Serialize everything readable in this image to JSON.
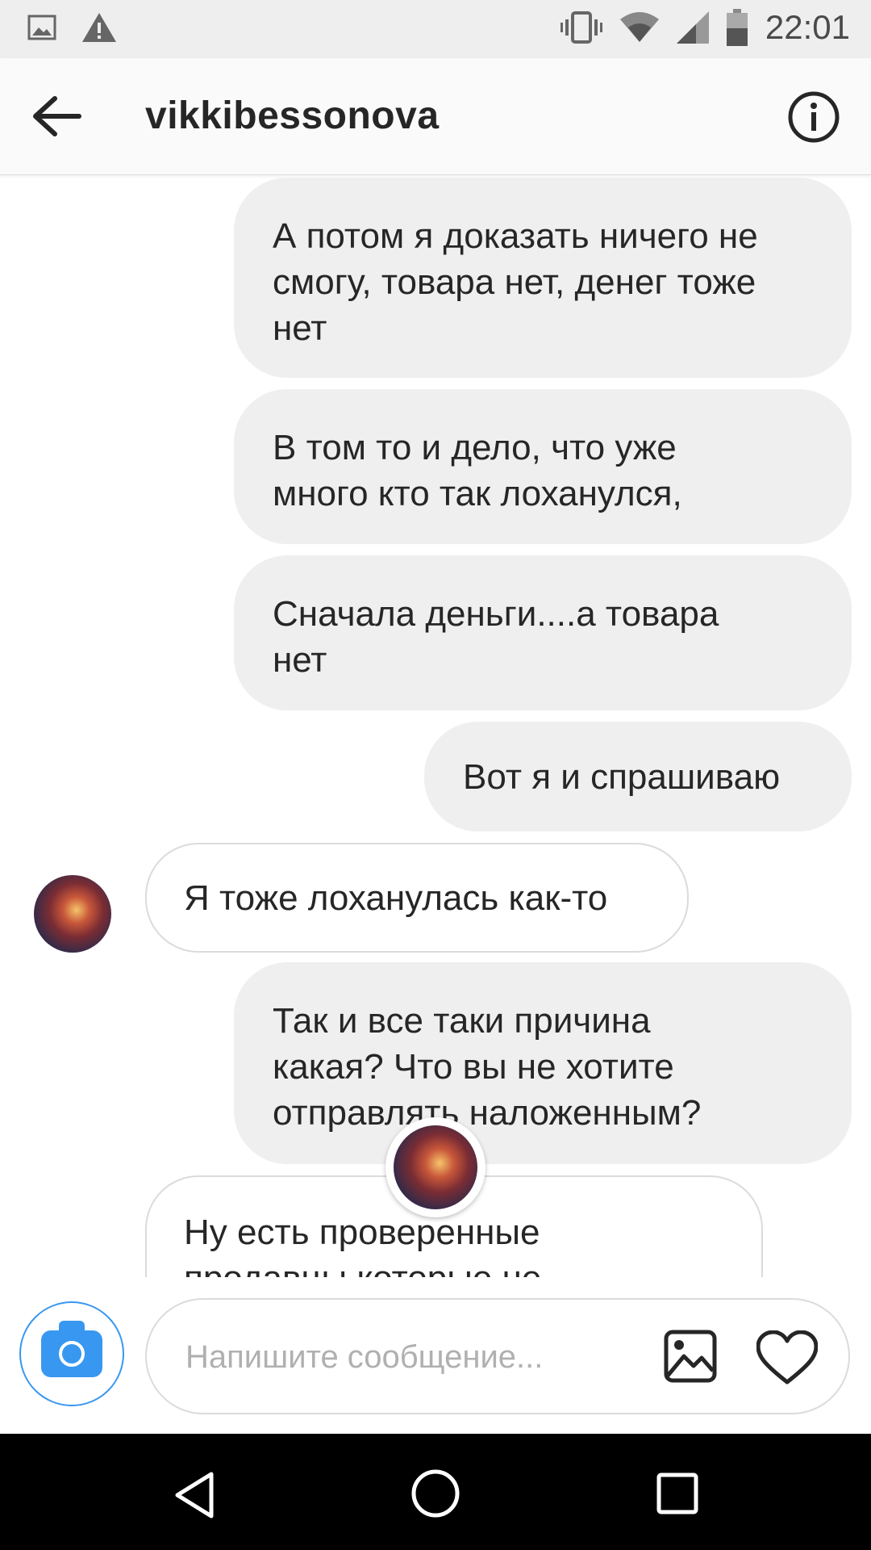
{
  "status_bar": {
    "time": "22:01",
    "icons": [
      "gallery-notification-icon",
      "warning-icon",
      "vibrate-icon",
      "wifi-icon",
      "signal-icon",
      "battery-icon"
    ]
  },
  "header": {
    "username": "vikkibessonova",
    "back_icon": "arrow-left-icon",
    "info_icon": "info-icon"
  },
  "messages": [
    {
      "direction": "sent",
      "lines": [
        "А потом я доказать ничего не",
        "смогу, товара нет, денег тоже",
        "нет"
      ]
    },
    {
      "direction": "sent",
      "lines": [
        "В том то и дело, что уже",
        "много кто так лоханулся,"
      ]
    },
    {
      "direction": "sent",
      "lines": [
        "Сначала деньги....а товара",
        "нет"
      ]
    },
    {
      "direction": "sent",
      "lines": [
        "Вот я и спрашиваю"
      ]
    },
    {
      "direction": "received",
      "lines": [
        "Я тоже лоханулась как-то"
      ]
    },
    {
      "direction": "sent",
      "lines": [
        "Так и все таки причина",
        "какая? Что вы не хотите",
        "отправлять наложенным?"
      ]
    },
    {
      "direction": "received",
      "lines": [
        "Ну есть проверенные",
        "продавцы которые не"
      ]
    }
  ],
  "composer": {
    "placeholder": "Напишите сообщение...",
    "value": "",
    "camera_icon": "camera-icon",
    "gallery_icon": "gallery-icon",
    "like_icon": "heart-icon"
  },
  "nav_bar": {
    "buttons": [
      "back-triangle-icon",
      "home-circle-icon",
      "recents-square-icon"
    ]
  },
  "colors": {
    "accent": "#3897f0",
    "sent_bubble": "#efefef",
    "received_border": "#dbdbdb",
    "text": "#262626"
  }
}
